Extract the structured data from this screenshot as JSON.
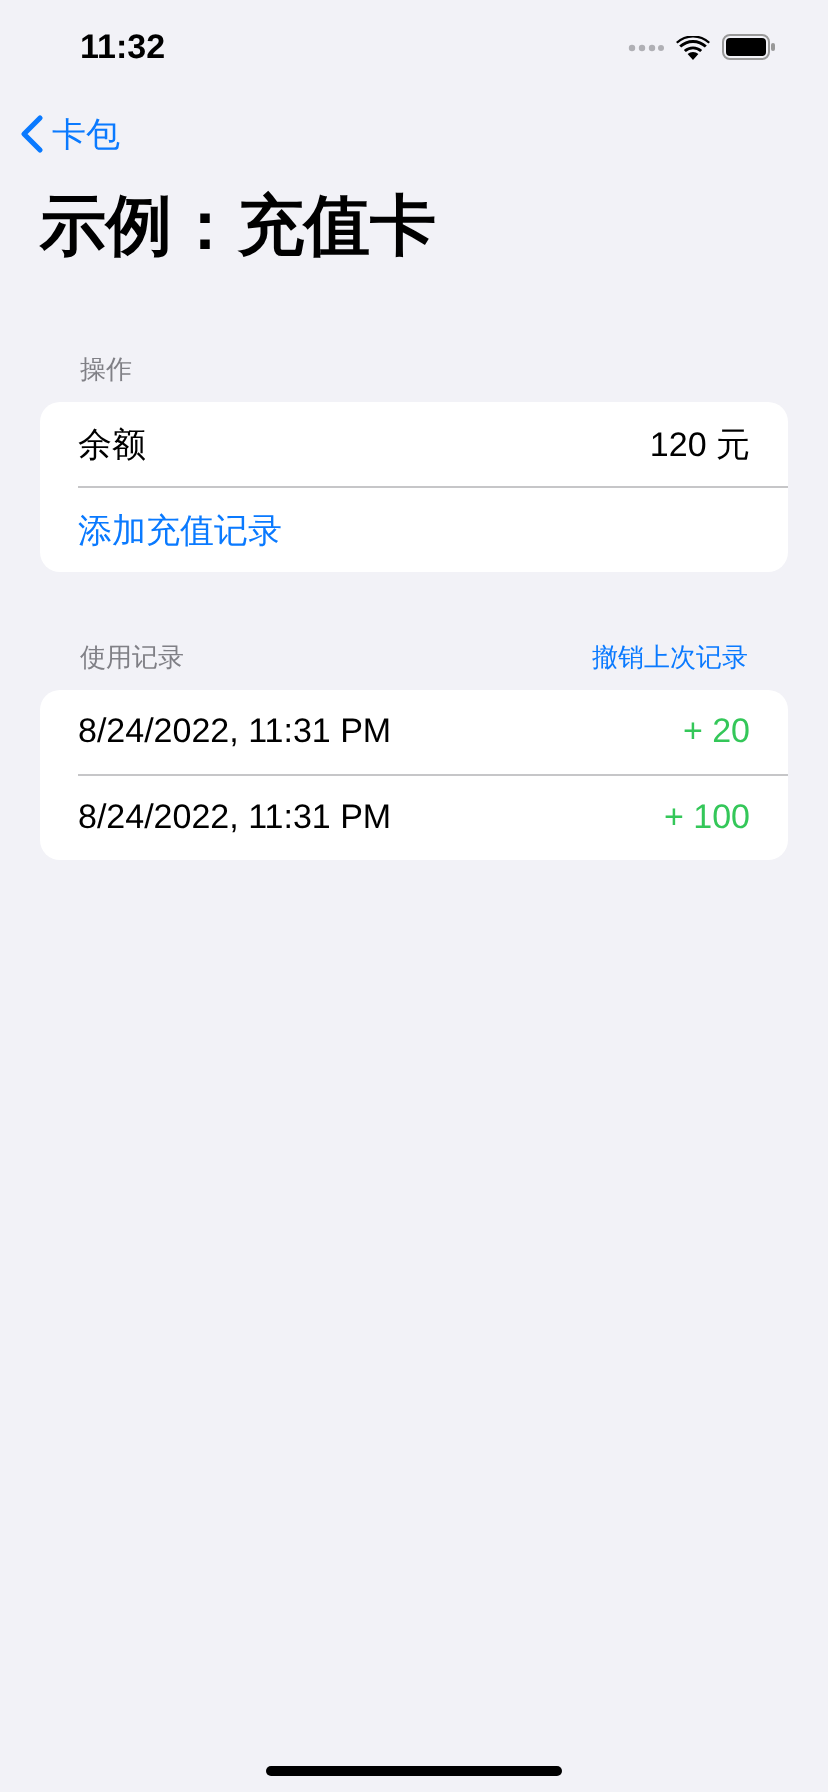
{
  "status_bar": {
    "time": "11:32"
  },
  "nav": {
    "back_label": "卡包"
  },
  "title": "示例：充值卡",
  "sections": [
    {
      "header": "操作",
      "rows": [
        {
          "kind": "value",
          "label": "余额",
          "value": "120 元"
        },
        {
          "kind": "action",
          "label": "添加充值记录"
        }
      ]
    },
    {
      "header": "使用记录",
      "header_action": "撤销上次记录",
      "rows": [
        {
          "kind": "record",
          "label": "8/24/2022, 11:31 PM",
          "value": "+ 20"
        },
        {
          "kind": "record",
          "label": "8/24/2022, 11:31 PM",
          "value": "+ 100"
        }
      ]
    }
  ]
}
